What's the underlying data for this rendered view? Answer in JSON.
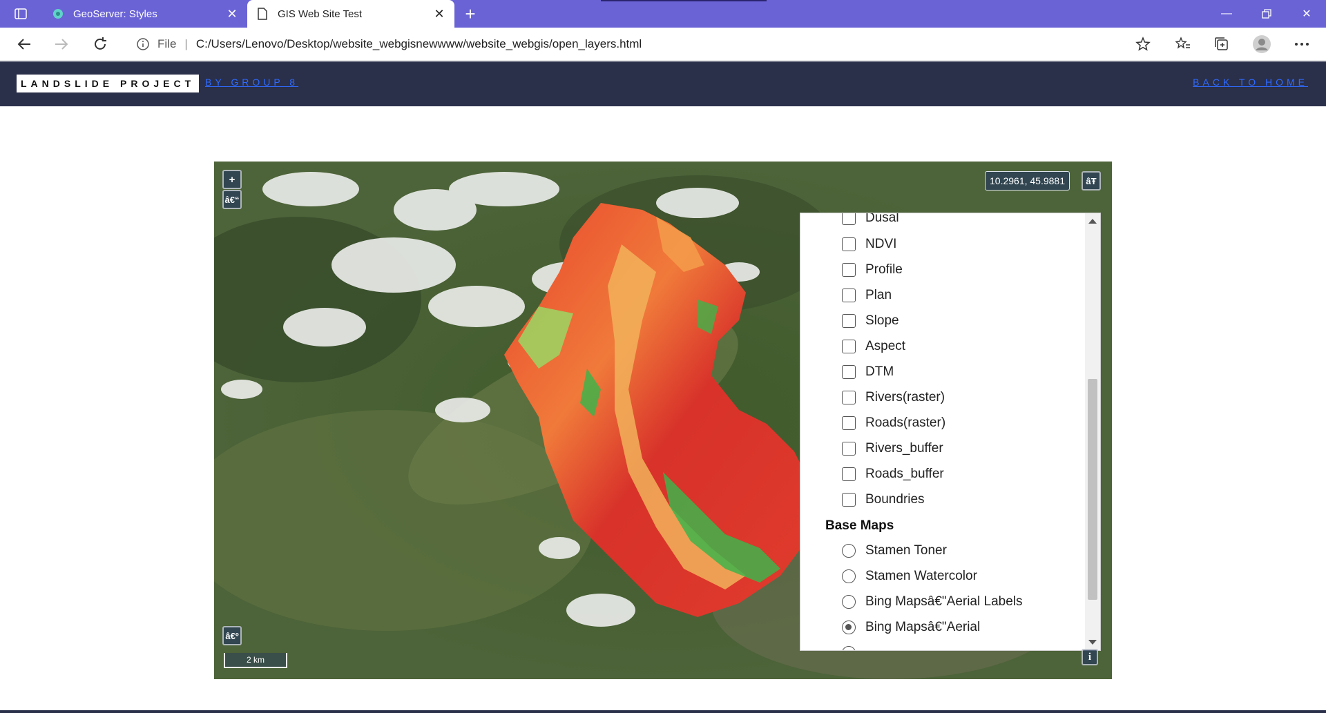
{
  "browser": {
    "tabs": [
      {
        "title": "GeoServer: Styles",
        "active": false
      },
      {
        "title": "GIS Web Site Test",
        "active": true
      }
    ],
    "address": {
      "scheme_label": "File",
      "url": "C:/Users/Lenovo/Desktop/website_webgisnewwww/website_webgis/open_layers.html"
    },
    "accent_color": "#6a63d6"
  },
  "header": {
    "brand": "LANDSLIDE PROJECT",
    "byline": "BY GROUP 8",
    "back_link": "BACK TO HOME"
  },
  "map": {
    "zoom_in_label": "+",
    "zoom_out_label": "â€“",
    "rotate_label": "â€º",
    "layer_switcher_label": "âŦ",
    "attribution_label": "i",
    "coordinates": "10.2961, 45.9881",
    "scale_label": "2 km",
    "layers": {
      "partial_top_label": "Dusal",
      "overlays": [
        {
          "label": "NDVI",
          "checked": false
        },
        {
          "label": "Profile",
          "checked": false
        },
        {
          "label": "Plan",
          "checked": false
        },
        {
          "label": "Slope",
          "checked": false
        },
        {
          "label": "Aspect",
          "checked": false
        },
        {
          "label": "DTM",
          "checked": false
        },
        {
          "label": "Rivers(raster)",
          "checked": false
        },
        {
          "label": "Roads(raster)",
          "checked": false
        },
        {
          "label": "Rivers_buffer",
          "checked": false
        },
        {
          "label": "Roads_buffer",
          "checked": false
        },
        {
          "label": "Boundries",
          "checked": false
        }
      ],
      "base_maps_title": "Base Maps",
      "base_maps": [
        {
          "label": "Stamen Toner",
          "selected": false
        },
        {
          "label": "Stamen Watercolor",
          "selected": false
        },
        {
          "label": "Bing Mapsâ€\"Aerial Labels",
          "selected": false
        },
        {
          "label": "Bing Mapsâ€\"Aerial",
          "selected": true
        }
      ]
    }
  }
}
